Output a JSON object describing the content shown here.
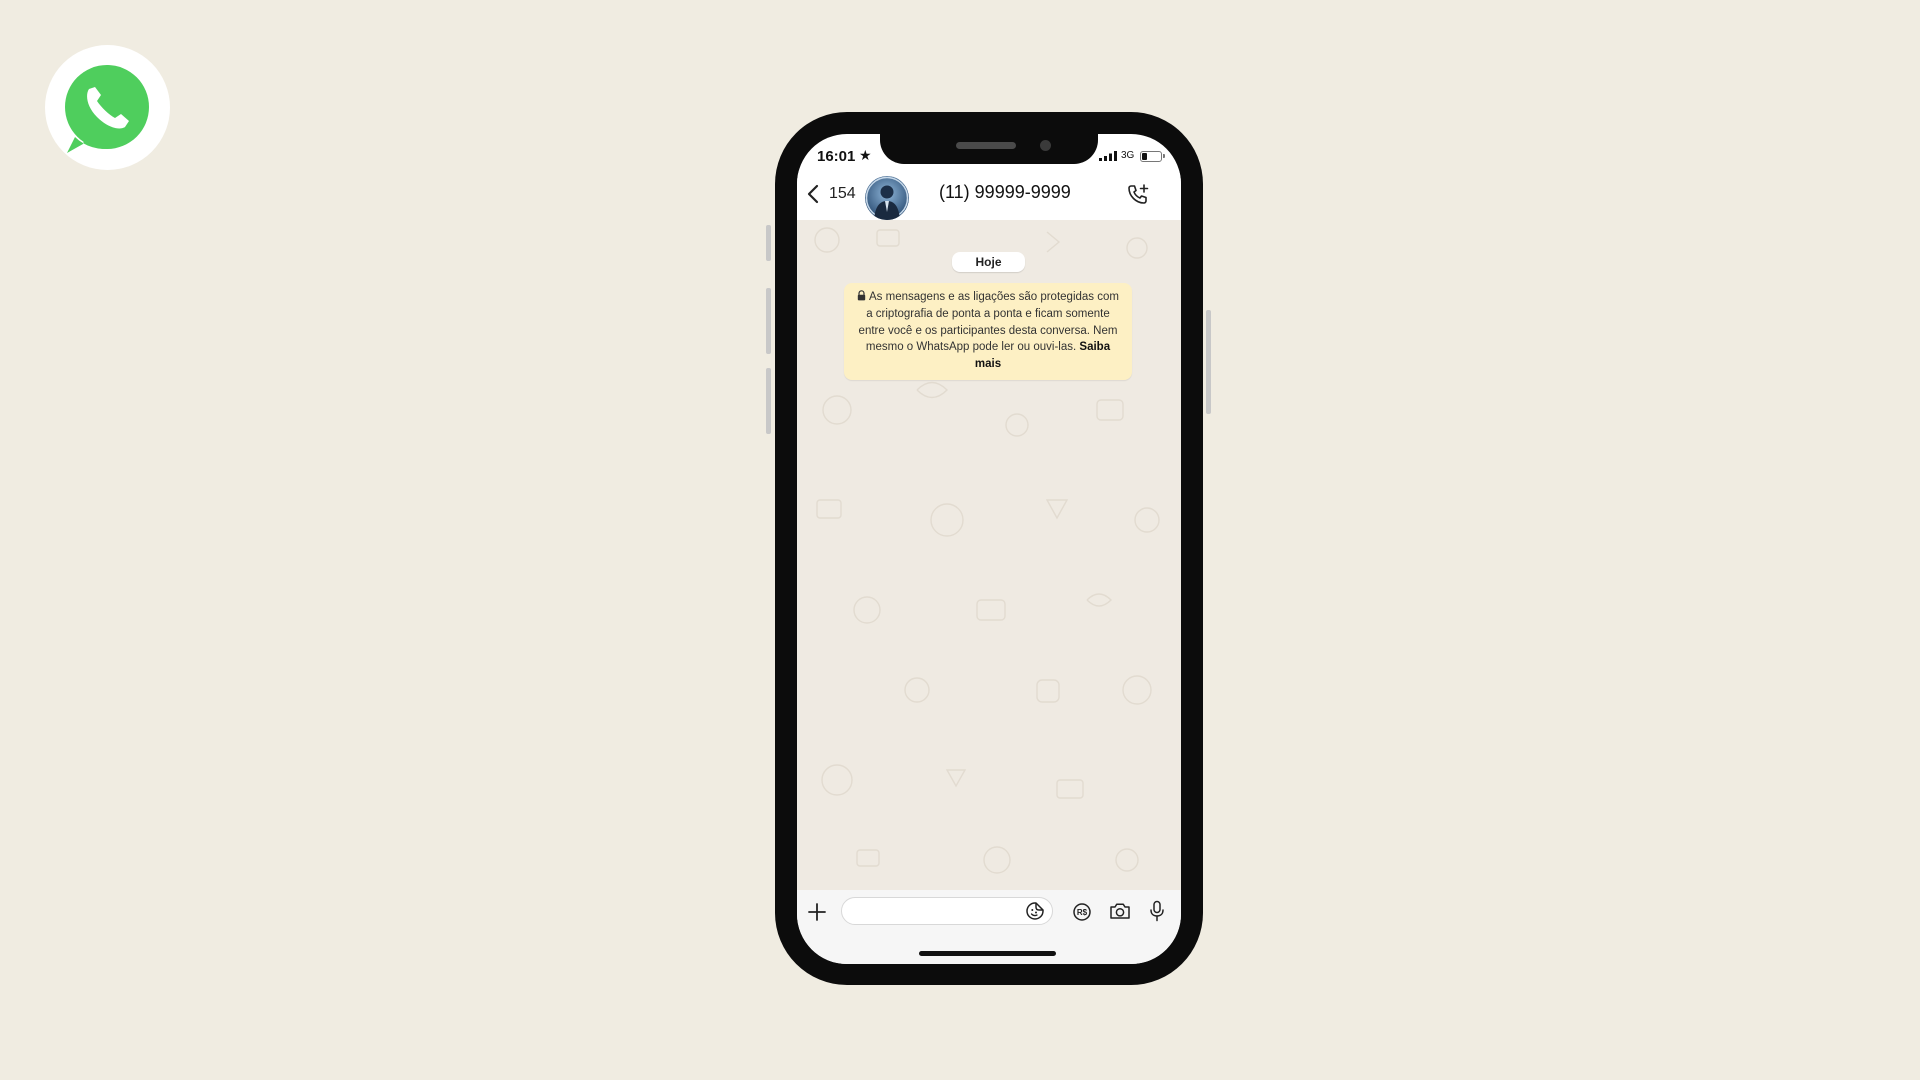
{
  "logo": {
    "icon": "whatsapp-logo-icon",
    "color": "#4fce5d"
  },
  "status_bar": {
    "time": "16:01",
    "star": "★",
    "network": "3G",
    "battery_level": 0.3
  },
  "header": {
    "back_count": "154",
    "contact_name": "(11) 99999-9999",
    "call_icon": "add-call-icon"
  },
  "chat": {
    "date_label": "Hoje",
    "encryption_notice": "As mensagens e as ligações são protegidas com a criptografia de ponta a ponta e ficam somente entre você e os participantes desta conversa. Nem mesmo o WhatsApp pode ler ou ouvi-las.",
    "learn_more": "Saiba mais",
    "background_color": "#efeae2",
    "notice_color": "#fdf0c4"
  },
  "composer": {
    "input_value": "",
    "icons": [
      "plus-icon",
      "sticker-icon",
      "pix-payment-icon",
      "camera-icon",
      "microphone-icon"
    ]
  }
}
